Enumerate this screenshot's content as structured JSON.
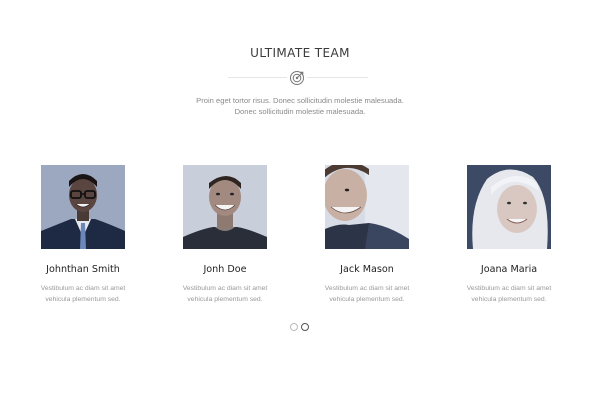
{
  "section": {
    "title": "ULTIMATE TEAM",
    "subtitle_line1": "Proin eget tortor risus. Donec sollicitudin molestie malesuada.",
    "subtitle_line2": "Donec sollicitudin molestie malesuada.",
    "divider_icon": "target-icon"
  },
  "members": [
    {
      "name": "Johnthan Smith",
      "desc_line1": "Vestibulum ac diam sit amet",
      "desc_line2": "vehicula plementum sed."
    },
    {
      "name": "Jonh Doe",
      "desc_line1": "Vestibulum ac diam sit amet",
      "desc_line2": "vehicula plementum sed."
    },
    {
      "name": "Jack Mason",
      "desc_line1": "Vestibulum ac diam sit amet",
      "desc_line2": "vehicula plementum sed."
    },
    {
      "name": "Joana Maria",
      "desc_line1": "Vestibulum ac diam sit amet",
      "desc_line2": "vehicula plementum sed."
    }
  ],
  "pagination": {
    "total": 2,
    "active": 2
  },
  "colors": {
    "photo_tint": "#5a6c96",
    "text": "#222222",
    "muted": "#999999"
  }
}
